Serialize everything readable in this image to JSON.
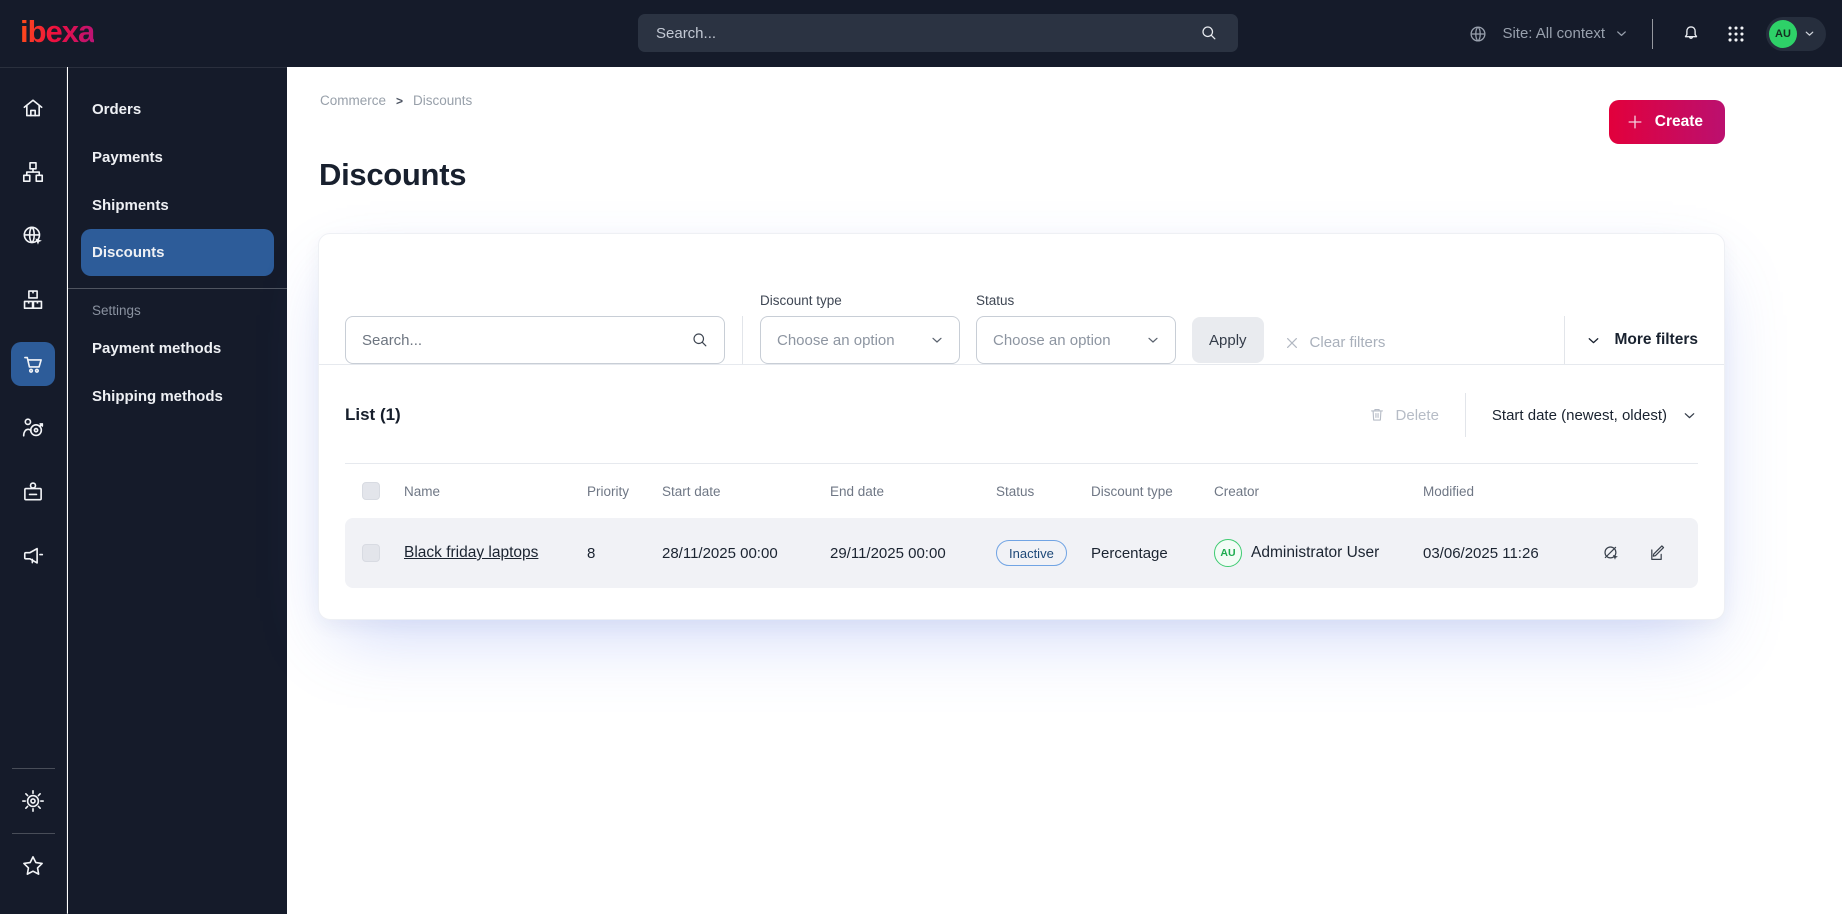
{
  "topbar": {
    "logo": "ibexa",
    "search_placeholder": "Search...",
    "site_context": "Site: All context",
    "avatar_initials": "AU"
  },
  "sidebar": {
    "rail_icons": [
      "home-icon",
      "content-tree-icon",
      "site-globe-icon",
      "products-boxes-icon",
      "commerce-cart-icon",
      "customer-target-icon",
      "corporate-badge-icon",
      "campaign-megaphone-icon"
    ],
    "rail_footer_icons": [
      "settings-gear-icon",
      "bookmarks-star-icon"
    ],
    "menu_items": [
      "Orders",
      "Payments",
      "Shipments",
      "Discounts"
    ],
    "active_item": "Discounts",
    "settings_label": "Settings",
    "settings_items": [
      "Payment methods",
      "Shipping methods"
    ]
  },
  "breadcrumb": [
    "Commerce",
    "Discounts"
  ],
  "page": {
    "title": "Discounts",
    "create_button": "Create"
  },
  "filters": {
    "search_placeholder": "Search...",
    "discount_type": {
      "label": "Discount type",
      "value": "Choose an option"
    },
    "status": {
      "label": "Status",
      "value": "Choose an option"
    },
    "apply_button": "Apply",
    "clear_filters": "Clear filters",
    "more_filters": "More filters"
  },
  "list": {
    "title": "List (1)",
    "delete_button": "Delete",
    "sort_by": "Start date (newest, oldest)",
    "columns": [
      "Name",
      "Priority",
      "Start date",
      "End date",
      "Status",
      "Discount type",
      "Creator",
      "Modified"
    ],
    "rows": [
      {
        "name": "Black friday laptops",
        "priority": "8",
        "start_date": "28/11/2025 00:00",
        "end_date": "29/11/2025 00:00",
        "status": "Inactive",
        "discount_type": "Percentage",
        "creator_initials": "AU",
        "creator": "Administrator User",
        "modified": "03/06/2025 11:26"
      }
    ]
  },
  "colors": {
    "topbar_bg": "#151b2a",
    "active_blue": "#2d5c99",
    "create_gradient_start": "#e2003c",
    "create_gradient_end": "#bb106f",
    "badge_inactive_border": "#71a4e4",
    "badge_inactive_text": "#1d4878",
    "avatar_green": "#2ed168"
  }
}
